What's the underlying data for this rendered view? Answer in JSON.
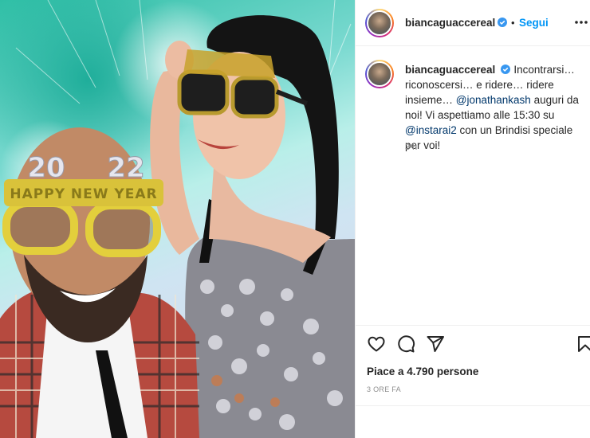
{
  "post": {
    "username": "biancaguaccereal",
    "follow_label": "Segui",
    "separator": "•",
    "caption": {
      "username": "biancaguaccereal",
      "part1": "Incontrarsi… riconoscersi… e ridere… ridere insieme… ",
      "mention1": "@jonathankash",
      "part2": " auguri da noi! Vi aspettiamo alle 15:30 su ",
      "mention2": "@instarai2",
      "part3": " con un Brindisi speciale per voi!"
    },
    "time_ago": "3 h",
    "likes_text": "Piace a 4.790 persone",
    "date_label": "3 ORE FA"
  },
  "photo": {
    "sign_left": "20",
    "sign_right": "22",
    "glasses_text": "HAPPY NEW YEAR"
  },
  "icons": {
    "verified": "verified-badge-icon",
    "more": "more-options-icon",
    "like": "heart-icon",
    "comment": "comment-icon",
    "share": "share-icon",
    "save": "bookmark-icon"
  },
  "colors": {
    "accent": "#0095f6",
    "mention": "#00376b",
    "muted": "#8e8e8e"
  }
}
